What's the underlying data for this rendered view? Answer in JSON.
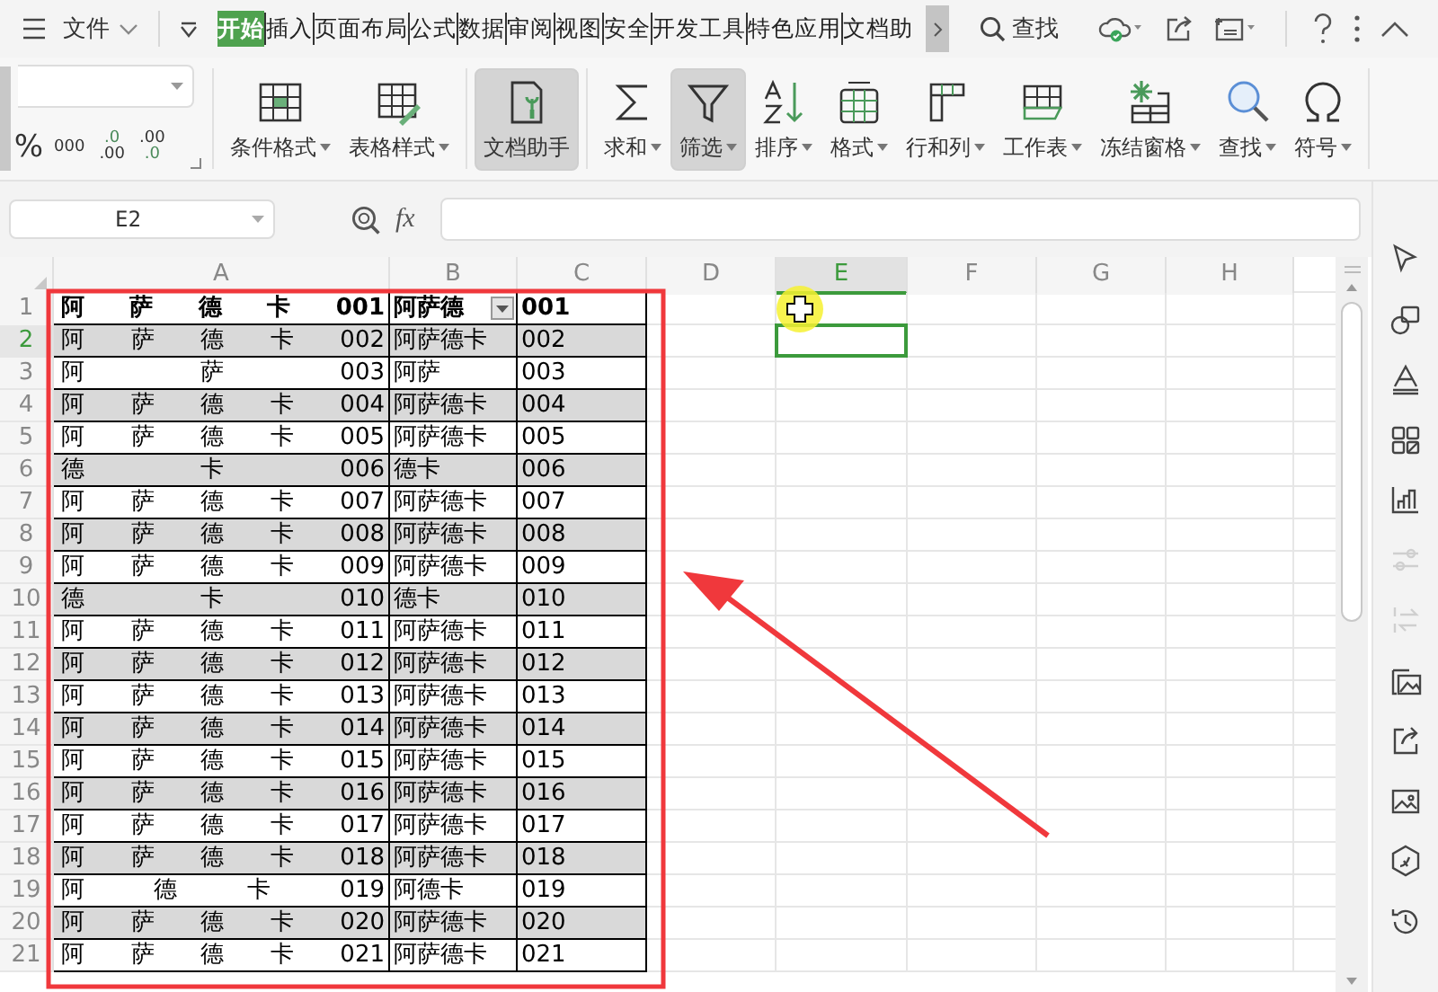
{
  "title_bar": {
    "file_menu": "文件",
    "search": "查找",
    "tabs": [
      {
        "label": "开始",
        "selected": true
      },
      {
        "label": "插入",
        "selected": false
      },
      {
        "label": "页面布局",
        "selected": false
      },
      {
        "label": "公式",
        "selected": false
      },
      {
        "label": "数据",
        "selected": false
      },
      {
        "label": "审阅",
        "selected": false
      },
      {
        "label": "视图",
        "selected": false
      },
      {
        "label": "安全",
        "selected": false
      },
      {
        "label": "开发工具",
        "selected": false
      },
      {
        "label": "特色应用",
        "selected": false
      },
      {
        "label": "文档助",
        "selected": false
      }
    ]
  },
  "ribbon": {
    "number_buttons": [
      {
        "kind": "percent",
        "lines": [
          "%"
        ]
      },
      {
        "kind": "thousands",
        "lines": [
          "000"
        ]
      },
      {
        "kind": "decimal-increase",
        "lines": [
          ".0",
          ".00"
        ]
      },
      {
        "kind": "decimal-decrease",
        "lines": [
          ".00",
          ".0"
        ]
      }
    ],
    "buttons": [
      {
        "kind": "conditional-format",
        "label": "条件格式",
        "dropdown": true,
        "pressed": false
      },
      {
        "kind": "table-style",
        "label": "表格样式",
        "dropdown": true,
        "pressed": false
      },
      {
        "kind": "doc-assistant",
        "label": "文档助手",
        "dropdown": false,
        "pressed": true
      },
      {
        "kind": "sum",
        "label": "求和",
        "dropdown": true,
        "pressed": false
      },
      {
        "kind": "filter",
        "label": "筛选",
        "dropdown": true,
        "pressed": true
      },
      {
        "kind": "sort",
        "label": "排序",
        "dropdown": true,
        "pressed": false
      },
      {
        "kind": "format",
        "label": "格式",
        "dropdown": true,
        "pressed": false
      },
      {
        "kind": "rows-cols",
        "label": "行和列",
        "dropdown": true,
        "pressed": false
      },
      {
        "kind": "worksheet",
        "label": "工作表",
        "dropdown": true,
        "pressed": false
      },
      {
        "kind": "freeze",
        "label": "冻结窗格",
        "dropdown": true,
        "pressed": false
      },
      {
        "kind": "find",
        "label": "查找",
        "dropdown": true,
        "pressed": false
      },
      {
        "kind": "symbol",
        "label": "符号",
        "dropdown": true,
        "pressed": false
      }
    ]
  },
  "formula_bar": {
    "name_box": "E2",
    "fx": "fx"
  },
  "sheet": {
    "columns": [
      {
        "label": "A",
        "selected": false
      },
      {
        "label": "B",
        "selected": false
      },
      {
        "label": "C",
        "selected": false
      },
      {
        "label": "D",
        "selected": false
      },
      {
        "label": "E",
        "selected": true
      },
      {
        "label": "F",
        "selected": false
      },
      {
        "label": "G",
        "selected": false
      },
      {
        "label": "H",
        "selected": false
      }
    ],
    "rows": [
      {
        "number": "1",
        "selected": false,
        "kind": "header",
        "shaded": false,
        "filter": true,
        "a": "阿 萨 德 卡 001",
        "b": "阿萨德",
        "c": "001"
      },
      {
        "number": "2",
        "selected": true,
        "kind": "data",
        "shaded": true,
        "filter": false,
        "a": "阿 萨 德 卡 002",
        "b": "阿萨德卡",
        "c": "002"
      },
      {
        "number": "3",
        "selected": false,
        "kind": "data",
        "shaded": false,
        "filter": false,
        "a": "阿 萨 003",
        "b": "阿萨",
        "c": "003"
      },
      {
        "number": "4",
        "selected": false,
        "kind": "data",
        "shaded": true,
        "filter": false,
        "a": "阿 萨 德 卡 004",
        "b": "阿萨德卡",
        "c": "004"
      },
      {
        "number": "5",
        "selected": false,
        "kind": "data",
        "shaded": false,
        "filter": false,
        "a": "阿 萨 德 卡 005",
        "b": "阿萨德卡",
        "c": "005"
      },
      {
        "number": "6",
        "selected": false,
        "kind": "data",
        "shaded": true,
        "filter": false,
        "a": "德 卡 006",
        "b": "德卡",
        "c": "006"
      },
      {
        "number": "7",
        "selected": false,
        "kind": "data",
        "shaded": false,
        "filter": false,
        "a": "阿 萨 德 卡 007",
        "b": "阿萨德卡",
        "c": "007"
      },
      {
        "number": "8",
        "selected": false,
        "kind": "data",
        "shaded": true,
        "filter": false,
        "a": "阿 萨 德 卡 008",
        "b": "阿萨德卡",
        "c": "008"
      },
      {
        "number": "9",
        "selected": false,
        "kind": "data",
        "shaded": false,
        "filter": false,
        "a": "阿 萨 德 卡 009",
        "b": "阿萨德卡",
        "c": "009"
      },
      {
        "number": "10",
        "selected": false,
        "kind": "data",
        "shaded": true,
        "filter": false,
        "a": "德 卡 010",
        "b": "德卡",
        "c": "010"
      },
      {
        "number": "11",
        "selected": false,
        "kind": "data",
        "shaded": false,
        "filter": false,
        "a": "阿 萨 德 卡 011",
        "b": "阿萨德卡",
        "c": "011"
      },
      {
        "number": "12",
        "selected": false,
        "kind": "data",
        "shaded": true,
        "filter": false,
        "a": "阿 萨 德 卡 012",
        "b": "阿萨德卡",
        "c": "012"
      },
      {
        "number": "13",
        "selected": false,
        "kind": "data",
        "shaded": false,
        "filter": false,
        "a": "阿 萨 德 卡 013",
        "b": "阿萨德卡",
        "c": "013"
      },
      {
        "number": "14",
        "selected": false,
        "kind": "data",
        "shaded": true,
        "filter": false,
        "a": "阿 萨 德 卡 014",
        "b": "阿萨德卡",
        "c": "014"
      },
      {
        "number": "15",
        "selected": false,
        "kind": "data",
        "shaded": false,
        "filter": false,
        "a": "阿 萨 德 卡 015",
        "b": "阿萨德卡",
        "c": "015"
      },
      {
        "number": "16",
        "selected": false,
        "kind": "data",
        "shaded": true,
        "filter": false,
        "a": "阿 萨 德 卡 016",
        "b": "阿萨德卡",
        "c": "016"
      },
      {
        "number": "17",
        "selected": false,
        "kind": "data",
        "shaded": false,
        "filter": false,
        "a": "阿 萨 德 卡 017",
        "b": "阿萨德卡",
        "c": "017"
      },
      {
        "number": "18",
        "selected": false,
        "kind": "data",
        "shaded": true,
        "filter": false,
        "a": "阿 萨 德 卡 018",
        "b": "阿萨德卡",
        "c": "018"
      },
      {
        "number": "19",
        "selected": false,
        "kind": "data",
        "shaded": false,
        "filter": false,
        "a": "阿 德 卡 019",
        "b": "阿德卡",
        "c": "019"
      },
      {
        "number": "20",
        "selected": false,
        "kind": "data",
        "shaded": true,
        "filter": false,
        "a": "阿 萨 德 卡 020",
        "b": "阿萨德卡",
        "c": "020"
      },
      {
        "number": "21",
        "selected": false,
        "kind": "data",
        "shaded": false,
        "filter": false,
        "a": "阿 萨 德 卡 021",
        "b": "阿萨德卡",
        "c": "021"
      }
    ]
  },
  "sidebar": {
    "tools": [
      {
        "kind": "pointer",
        "disabled": false
      },
      {
        "kind": "shapes",
        "disabled": false
      },
      {
        "kind": "text-style",
        "disabled": false
      },
      {
        "kind": "apps",
        "disabled": false
      },
      {
        "kind": "chart",
        "disabled": false
      },
      {
        "kind": "sliders",
        "disabled": true
      },
      {
        "kind": "swap",
        "disabled": true
      },
      {
        "kind": "gallery",
        "disabled": false
      },
      {
        "kind": "share",
        "disabled": false
      },
      {
        "kind": "image",
        "disabled": false
      },
      {
        "kind": "plugin",
        "disabled": false
      },
      {
        "kind": "history",
        "disabled": false
      }
    ]
  }
}
